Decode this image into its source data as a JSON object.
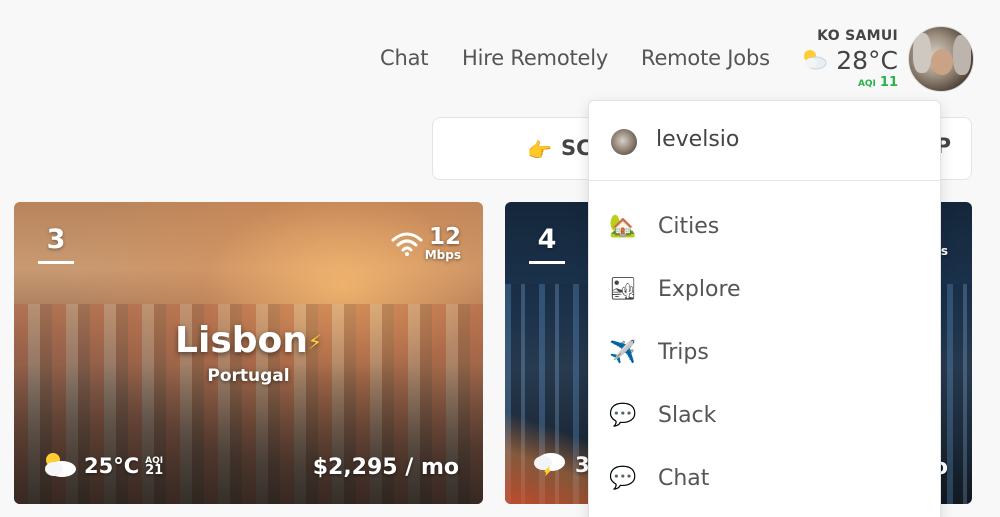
{
  "nav": {
    "links": [
      "Chat",
      "Hire Remotely",
      "Remote Jobs"
    ]
  },
  "weather": {
    "city": "KO SAMUI",
    "temp": "28°C",
    "aqi_label": "AQI",
    "aqi_value": "11",
    "icon": "partly-cloudy-icon",
    "aqi_color": "#2bb34a"
  },
  "search": {
    "hand_icon": "👉",
    "text": "SC",
    "end_text": "P"
  },
  "cards": [
    {
      "rank": "3",
      "wifi_speed": "12",
      "wifi_unit": "Mbps",
      "city": "Lisbon",
      "country": "Portugal",
      "temp": "25°C",
      "aqi_label": "AQI",
      "aqi_value": "21",
      "price": "$2,295 / mo"
    },
    {
      "rank": "4",
      "wifi_unit": "s",
      "temp": "3",
      "price": "o"
    }
  ],
  "dropdown": {
    "username": "levelsio",
    "items": [
      {
        "label": "Cities",
        "icon": "🏡"
      },
      {
        "label": "Explore",
        "icon": "🏜"
      },
      {
        "label": "Trips",
        "icon": "✈️"
      },
      {
        "label": "Slack",
        "icon": "💬"
      },
      {
        "label": "Chat",
        "icon": "💬"
      }
    ]
  }
}
